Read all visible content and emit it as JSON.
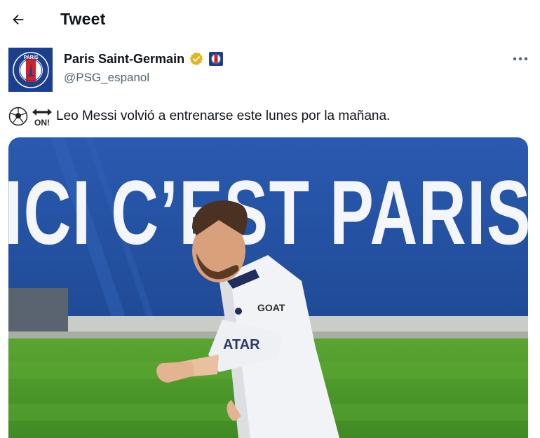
{
  "header": {
    "title": "Tweet",
    "back_icon": "arrow-left-icon"
  },
  "author": {
    "display_name": "Paris Saint-Germain",
    "handle": "@PSG_espanol",
    "avatar_text": "PARIS",
    "verified_badge": "gold-verified-badge-icon",
    "affiliate_badge": "psg-affiliate-badge-icon",
    "more_icon": "more-horizontal-icon"
  },
  "tweet": {
    "emojis": [
      "soccer-ball-icon",
      "on-arrow-icon"
    ],
    "text": "Leo Messi volvió a entrenarse este lunes por la mañana."
  },
  "media": {
    "banner_text": "ICI C’EST PARIS",
    "jersey_brand": "GOAT",
    "jersey_sponsor": "ATAR"
  },
  "colors": {
    "text": "#0f1419",
    "secondary": "#536471",
    "psg_blue": "#1b3f8f",
    "banner_blue": "#2453a6",
    "pitch_green": "#4e9a2c",
    "gold": "#e2b719"
  }
}
